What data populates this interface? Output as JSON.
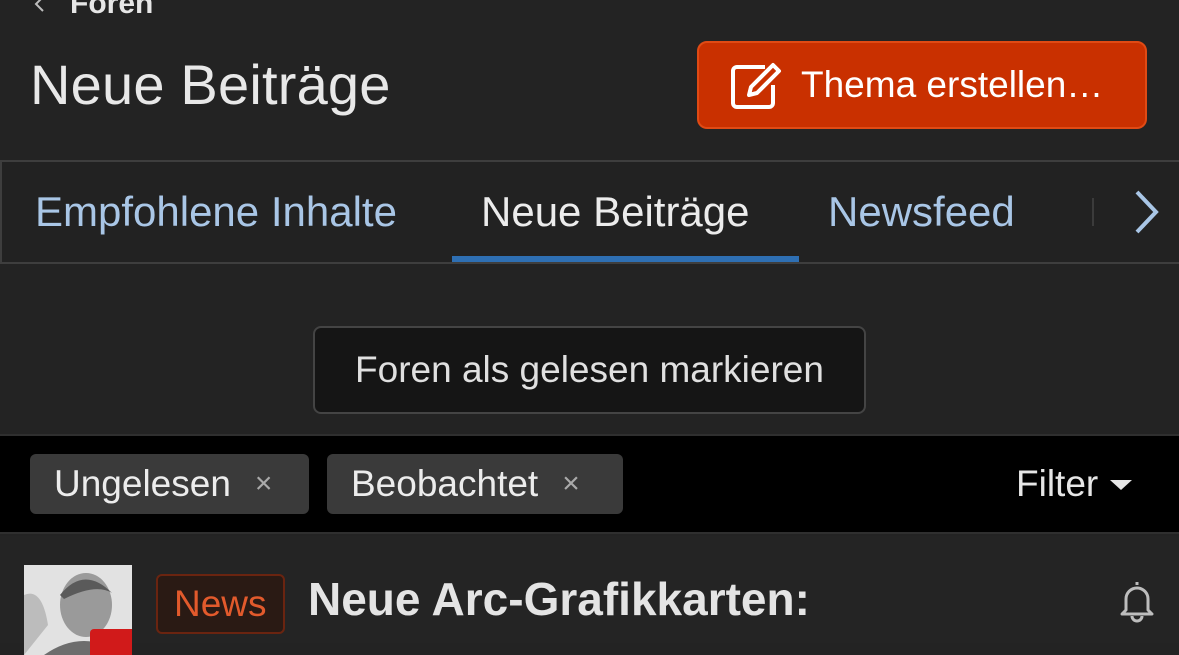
{
  "breadcrumb": {
    "parent": "Foren"
  },
  "page": {
    "title": "Neue Beiträge"
  },
  "actions": {
    "create_thread": "Thema erstellen…"
  },
  "tabs": [
    {
      "label": "Empfohlene Inhalte",
      "active": false
    },
    {
      "label": "Neue Beiträge",
      "active": true
    },
    {
      "label": "Newsfeed",
      "active": false
    }
  ],
  "mark_read": {
    "label": "Foren als gelesen markieren"
  },
  "filters": {
    "chips": [
      {
        "label": "Ungelesen",
        "remove": "×"
      },
      {
        "label": "Beobachtet",
        "remove": "×"
      }
    ],
    "toggle_label": "Filter"
  },
  "threads": [
    {
      "prefix": "News",
      "title": "Neue Arc-Grafikkarten:"
    }
  ],
  "colors": {
    "background": "#232323",
    "accent_button": "#c93000",
    "tab_link": "#a9c6e6",
    "tab_active_underline": "#2e6fb3",
    "prefix_text": "#e25a2c"
  },
  "icons": [
    "chevron-left-icon",
    "edit-icon",
    "chevron-right-icon",
    "close-icon",
    "caret-down-icon",
    "bell-icon"
  ]
}
